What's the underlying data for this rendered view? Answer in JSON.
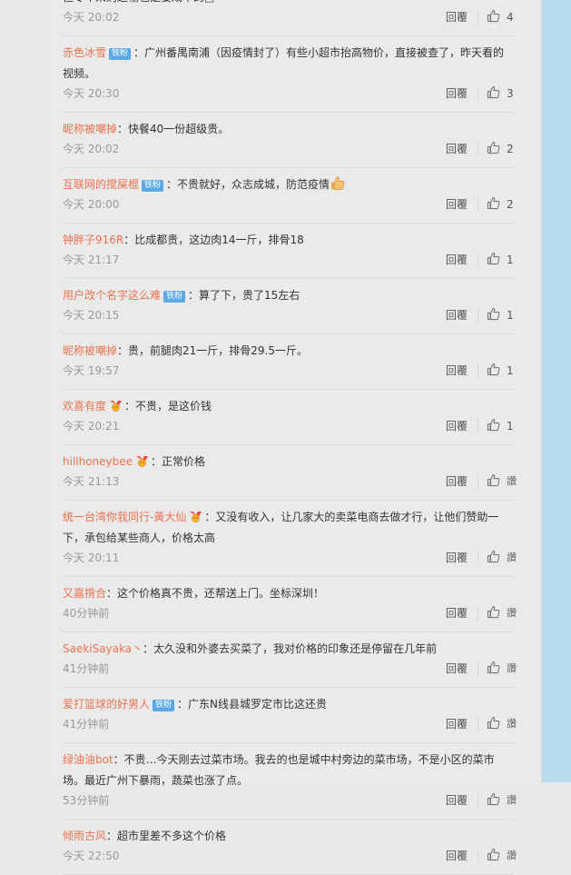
{
  "comments": [
    {
      "user": "",
      "badge": "",
      "medal": false,
      "thumb_emoji": false,
      "content": "但专车采购运输也是要成本的□",
      "time": "今天 20:02",
      "reply": "回覆",
      "likes": "4"
    },
    {
      "user": "赤色冰雪",
      "badge": "铁粉",
      "medal": false,
      "thumb_emoji": false,
      "content": "：广州番禺南浦（因疫情封了）有些小超市抬高物价，直接被查了，昨天看的视频。",
      "time": "今天 20:30",
      "reply": "回覆",
      "likes": "3"
    },
    {
      "user": "昵称被嘲掉",
      "badge": "",
      "medal": false,
      "thumb_emoji": false,
      "content": "：快餐40一份超级贵。",
      "time": "今天 20:02",
      "reply": "回覆",
      "likes": "2"
    },
    {
      "user": "互联网的搅屎棍",
      "badge": "铁粉",
      "medal": false,
      "thumb_emoji": true,
      "content": "：不贵就好，众志成城，防范疫情",
      "time": "今天 20:00",
      "reply": "回覆",
      "likes": "2"
    },
    {
      "user": "钟胖子916R",
      "badge": "",
      "medal": false,
      "thumb_emoji": false,
      "content": "：比成都贵，这边肉14一斤，排骨18",
      "time": "今天 21:17",
      "reply": "回覆",
      "likes": "1"
    },
    {
      "user": "用户改个名字这么难",
      "badge": "铁粉",
      "medal": false,
      "thumb_emoji": false,
      "content": "：算了下，贵了15左右",
      "time": "今天 20:15",
      "reply": "回覆",
      "likes": "1"
    },
    {
      "user": "昵称被嘲掉",
      "badge": "",
      "medal": false,
      "thumb_emoji": false,
      "content": "：贵，前腿肉21一斤，排骨29.5一斤。",
      "time": "今天 19:57",
      "reply": "回覆",
      "likes": "1"
    },
    {
      "user": "欢喜有度",
      "badge": "",
      "medal": true,
      "thumb_emoji": false,
      "content": "：不贵，是这价钱",
      "time": "今天 20:21",
      "reply": "回覆",
      "likes": "1"
    },
    {
      "user": "hillhoneybee",
      "badge": "",
      "medal": true,
      "thumb_emoji": false,
      "content": "：正常价格",
      "time": "今天 21:13",
      "reply": "回覆",
      "likes": "讚"
    },
    {
      "user": "统一台湾你我同行-黃大仙",
      "badge": "",
      "medal": true,
      "thumb_emoji": false,
      "content": "：又没有收入，让几家大的卖菜电商去做才行，让他们赞助一下，承包给某些商人，价格太高",
      "time": "今天 20:11",
      "reply": "回覆",
      "likes": "讚"
    },
    {
      "user": "又嘉揹合",
      "badge": "",
      "medal": false,
      "thumb_emoji": false,
      "content": "：这个价格真不贵，还帮送上门。坐标深圳！",
      "time": "40分钟前",
      "reply": "回覆",
      "likes": "讚"
    },
    {
      "user": "SaekiSayaka丶",
      "badge": "",
      "medal": false,
      "thumb_emoji": false,
      "content": "：太久没和外婆去买菜了，我对价格的印象还是停留在几年前",
      "time": "41分钟前",
      "reply": "回覆",
      "likes": "讚"
    },
    {
      "user": "爱打篮球的好男人",
      "badge": "铁粉",
      "medal": false,
      "thumb_emoji": false,
      "content": "：广东N线县城罗定市比这还贵",
      "time": "41分钟前",
      "reply": "回覆",
      "likes": "讚"
    },
    {
      "user": "绿油油bot",
      "badge": "",
      "medal": false,
      "thumb_emoji": false,
      "content": "：不贵…今天刚去过菜市场。我去的也是城中村旁边的菜市场，不是小区的菜市场。最近广州下暴雨，蔬菜也涨了点。",
      "time": "53分钟前",
      "reply": "回覆",
      "likes": "讚"
    },
    {
      "user": "倾雨古风",
      "badge": "",
      "medal": false,
      "thumb_emoji": false,
      "content": "：超市里差不多这个价格",
      "time": "今天 22:50",
      "reply": "回覆",
      "likes": "讚"
    }
  ],
  "colors": {
    "username": "#eb7350",
    "badge": "#5aa9e6",
    "page": "#eaeaea",
    "side_band": "#b9dcef"
  },
  "icons": {
    "like": "thumbs-up-icon",
    "medal": "medal-icon",
    "thumb_emoji": "thumbs-up-emoji-icon"
  }
}
